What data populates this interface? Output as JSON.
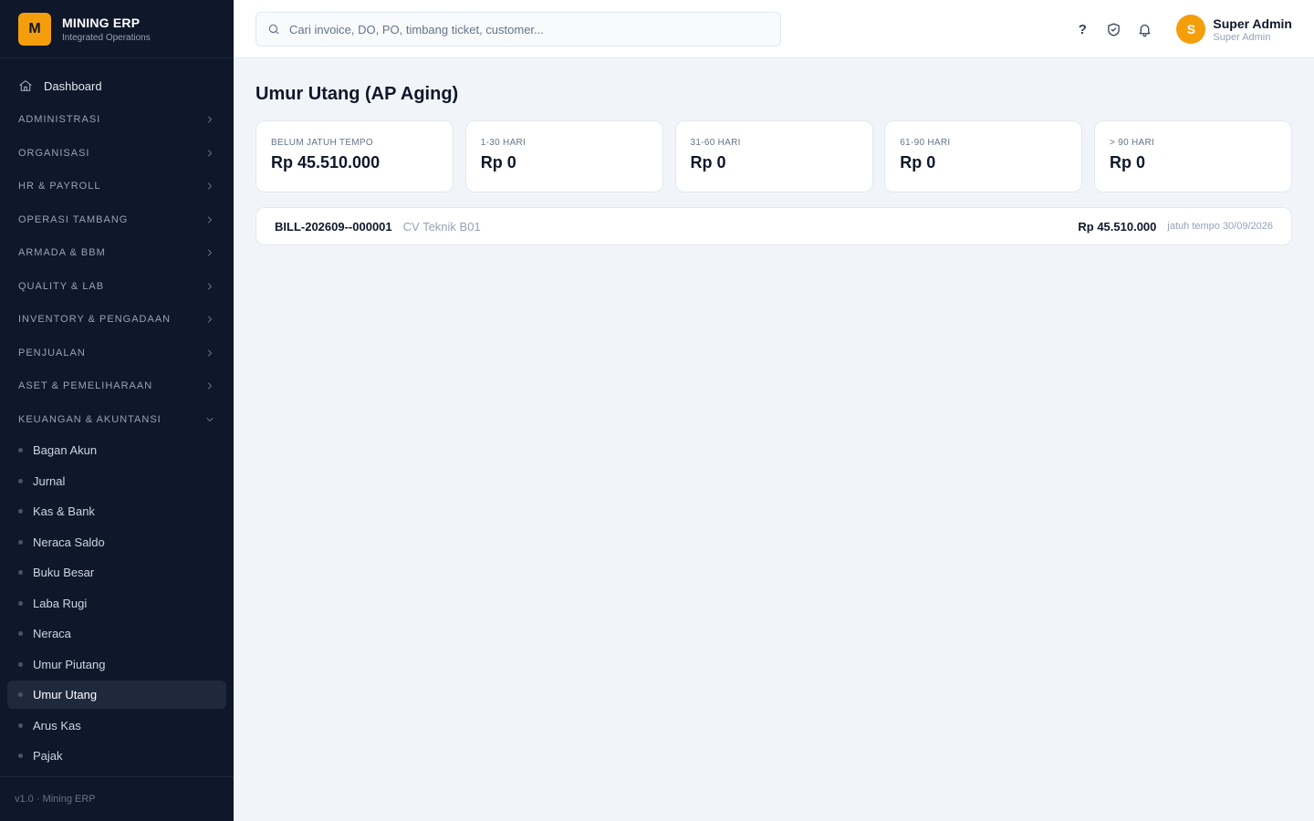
{
  "brand": {
    "logo_letter": "M",
    "name": "MINING ERP",
    "subtitle": "Integrated Operations"
  },
  "sidebar": {
    "dashboard_label": "Dashboard",
    "groups": [
      {
        "label": "ADMINISTRASI",
        "expanded": false
      },
      {
        "label": "ORGANISASI",
        "expanded": false
      },
      {
        "label": "HR & PAYROLL",
        "expanded": false
      },
      {
        "label": "OPERASI TAMBANG",
        "expanded": false
      },
      {
        "label": "ARMADA & BBM",
        "expanded": false
      },
      {
        "label": "QUALITY & LAB",
        "expanded": false
      },
      {
        "label": "INVENTORY & PENGADAAN",
        "expanded": false
      },
      {
        "label": "PENJUALAN",
        "expanded": false
      },
      {
        "label": "ASET & PEMELIHARAAN",
        "expanded": false
      },
      {
        "label": "KEUANGAN & AKUNTANSI",
        "expanded": true
      }
    ],
    "finance_items": [
      {
        "label": "Bagan Akun"
      },
      {
        "label": "Jurnal"
      },
      {
        "label": "Kas & Bank"
      },
      {
        "label": "Neraca Saldo"
      },
      {
        "label": "Buku Besar"
      },
      {
        "label": "Laba Rugi"
      },
      {
        "label": "Neraca"
      },
      {
        "label": "Umur Piutang"
      },
      {
        "label": "Umur Utang",
        "active": true
      },
      {
        "label": "Arus Kas"
      },
      {
        "label": "Pajak"
      }
    ],
    "version": "v1.0 · Mining ERP"
  },
  "topbar": {
    "search_placeholder": "Cari invoice, DO, PO, timbang ticket, customer...",
    "help_label": "?",
    "user": {
      "initial": "S",
      "name": "Super Admin",
      "role": "Super Admin"
    }
  },
  "page": {
    "title": "Umur Utang (AP Aging)",
    "cards": [
      {
        "label": "BELUM JATUH TEMPO",
        "value": "Rp 45.510.000"
      },
      {
        "label": "1-30 HARI",
        "value": "Rp 0"
      },
      {
        "label": "31-60 HARI",
        "value": "Rp 0"
      },
      {
        "label": "61-90 HARI",
        "value": "Rp 0"
      },
      {
        "label": "> 90 HARI",
        "value": "Rp 0"
      }
    ],
    "bills": [
      {
        "number": "BILL-202609--000001",
        "vendor": "CV Teknik B01",
        "amount": "Rp 45.510.000",
        "due": "jatuh tempo 30/09/2026"
      }
    ]
  },
  "colors": {
    "sidebar_bg": "#0f172a",
    "accent": "#f59e0b",
    "page_bg": "#f1f5f9"
  }
}
